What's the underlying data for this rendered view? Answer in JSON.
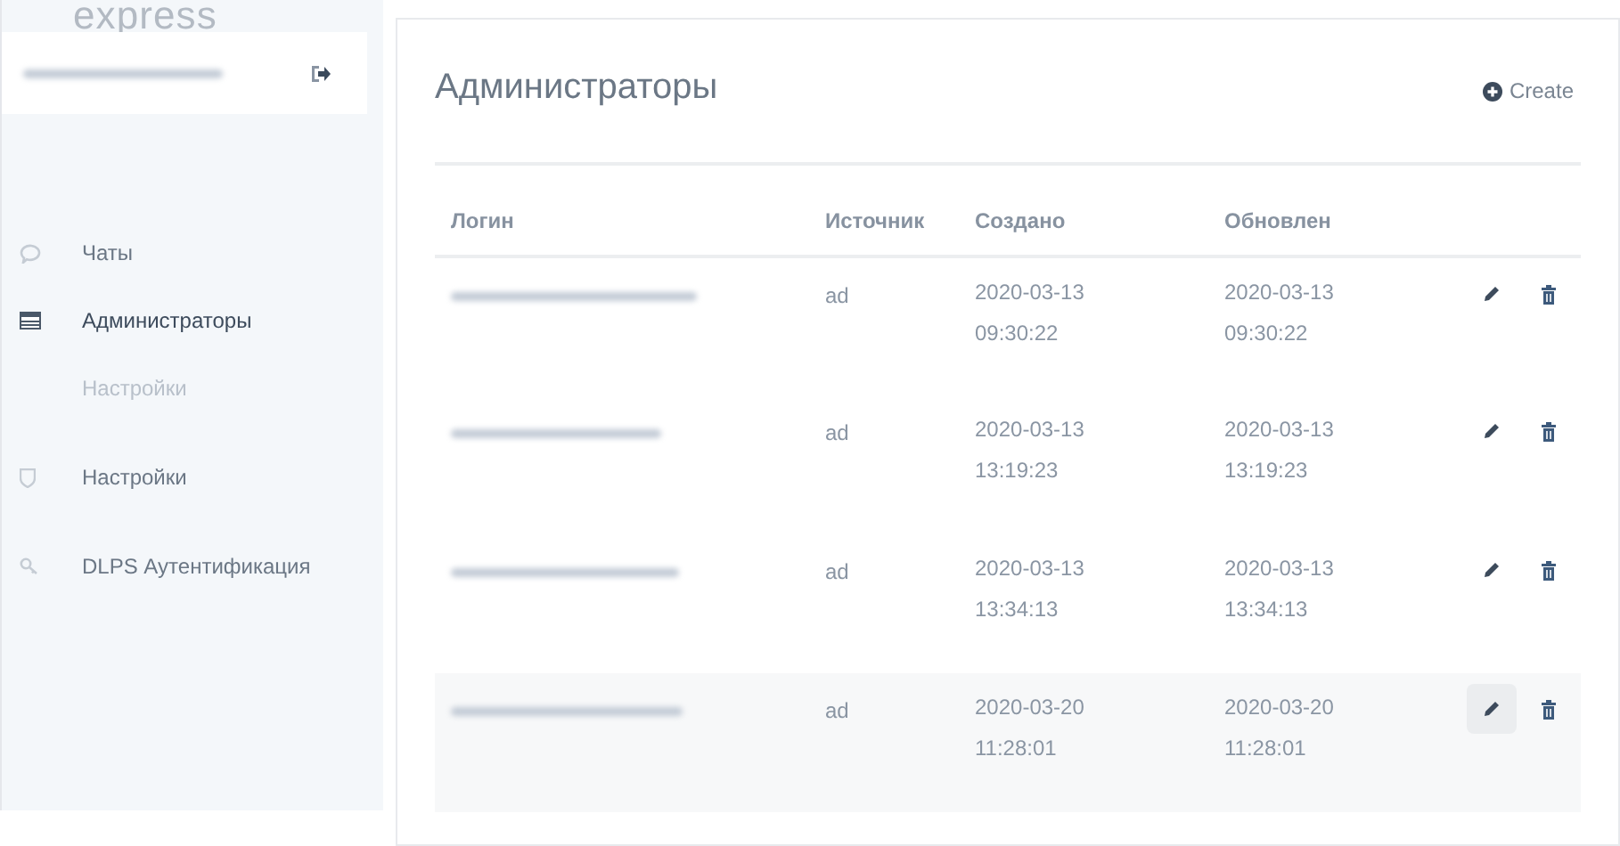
{
  "logo": {
    "text": "express"
  },
  "sidebar": {
    "items": [
      {
        "label": "Чаты",
        "kind": "main",
        "selected": false
      },
      {
        "label": "Администраторы",
        "kind": "main",
        "selected": true
      },
      {
        "label": "Настройки",
        "kind": "sub",
        "selected": false
      },
      {
        "label": "Настройки",
        "kind": "main",
        "selected": false
      },
      {
        "label": "DLPS Аутентификация",
        "kind": "main",
        "selected": false
      }
    ]
  },
  "page": {
    "title": "Администраторы",
    "create_button": "Create"
  },
  "table": {
    "columns": [
      "Логин",
      "Источник",
      "Создано",
      "Обновлен"
    ],
    "rows": [
      {
        "source": "ad",
        "created": [
          "2020-03-13",
          "09:30:22"
        ],
        "updated": [
          "2020-03-13",
          "09:30:22"
        ],
        "highlighted": false
      },
      {
        "source": "ad",
        "created": [
          "2020-03-13",
          "13:19:23"
        ],
        "updated": [
          "2020-03-13",
          "13:19:23"
        ],
        "highlighted": false
      },
      {
        "source": "ad",
        "created": [
          "2020-03-13",
          "13:34:13"
        ],
        "updated": [
          "2020-03-13",
          "13:34:13"
        ],
        "highlighted": false
      },
      {
        "source": "ad",
        "created": [
          "2020-03-20",
          "11:28:01"
        ],
        "updated": [
          "2020-03-20",
          "11:28:01"
        ],
        "highlighted": true
      }
    ]
  }
}
